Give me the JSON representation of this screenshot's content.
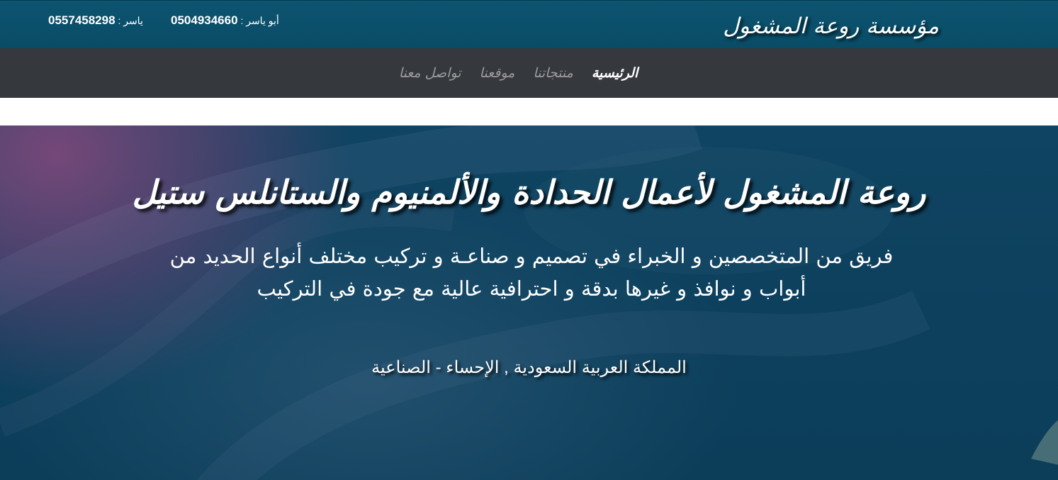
{
  "header": {
    "brand": "مؤسسة روعة المشغول",
    "contacts": [
      {
        "label": "أبو ياسر :",
        "number": "0504934660"
      },
      {
        "label": "ياسر :",
        "number": "0557458298"
      }
    ],
    "colors": {
      "background": "#0b5069",
      "text": "#ffffff"
    }
  },
  "nav": {
    "items": [
      {
        "label": "الرئيسية",
        "active": true
      },
      {
        "label": "منتجاتنا",
        "active": false
      },
      {
        "label": "موقعنا",
        "active": false
      },
      {
        "label": "تواصل معنا",
        "active": false
      }
    ],
    "colors": {
      "background": "#35383c",
      "active": "#ffffff",
      "inactive": "#9a9b9c"
    }
  },
  "hero": {
    "title": "روعة المشغول لأعمال الحدادة والألمنيوم والستانلس ستيل",
    "description_line1": "فريق من المتخصصين و الخبراء في تصميم و صناعـة و تركيب مختلف أنواع الحديد من",
    "description_line2": "أبواب و نوافذ و غيرها بدقة و احترافية عالية مع جودة في التركيب",
    "location": "المملكة العربية السعودية , الإحساء - الصناعية",
    "colors": {
      "top_left": "#7a487a",
      "base": "#0d415e"
    }
  }
}
